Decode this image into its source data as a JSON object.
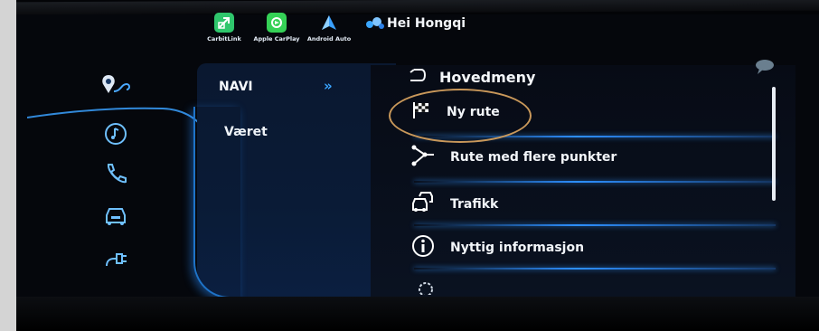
{
  "topbar": {
    "apps": [
      {
        "label": "CarbitLink",
        "icon": "carbitlink-icon",
        "color": "#2fc66c"
      },
      {
        "label": "Apple CarPlay",
        "icon": "carplay-icon",
        "color": "#35d156"
      },
      {
        "label": "Android Auto",
        "icon": "android-auto-icon",
        "color": "#3aa0ff"
      }
    ],
    "greeting": "Hei Hongqi"
  },
  "sidebar": {
    "items": [
      {
        "name": "navigation-icon",
        "active": true
      },
      {
        "name": "music-icon"
      },
      {
        "name": "phone-icon"
      },
      {
        "name": "car-icon"
      },
      {
        "name": "charging-icon"
      }
    ]
  },
  "submenu": {
    "active_label": "NAVI",
    "second_label": "Været"
  },
  "menu": {
    "title": "Hovedmeny",
    "items": [
      {
        "label": "Ny rute",
        "icon": "checkered-flag-icon"
      },
      {
        "label": "Rute med flere punkter",
        "icon": "multi-waypoint-icon"
      },
      {
        "label": "Trafikk",
        "icon": "traffic-icon"
      },
      {
        "label": "Nyttig informasjon",
        "icon": "info-icon"
      }
    ]
  },
  "colors": {
    "accent": "#2d8fff",
    "highlight_circle": "#c9985a"
  }
}
